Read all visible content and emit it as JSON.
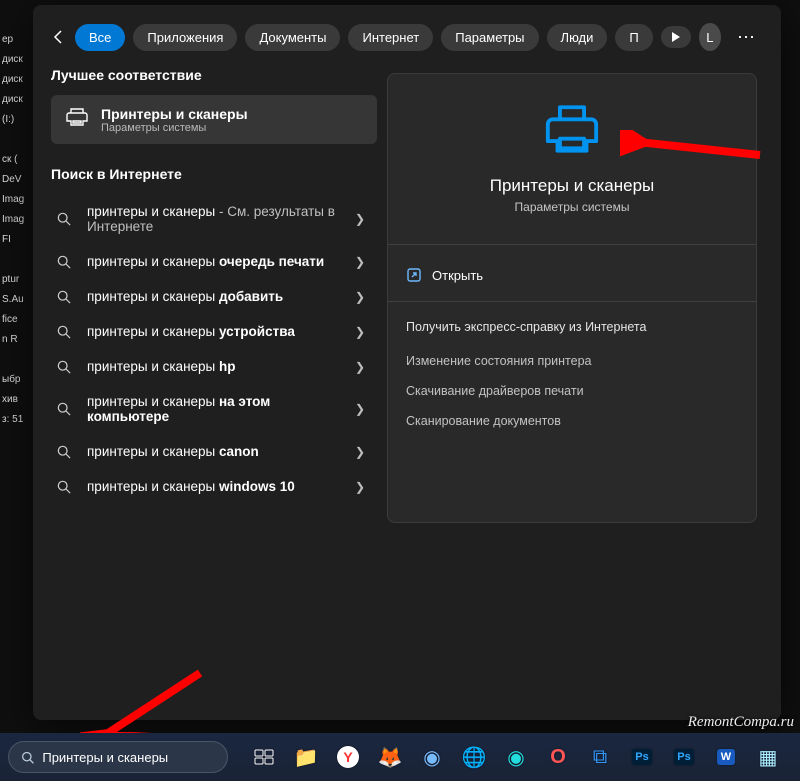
{
  "filters": {
    "all": "Все",
    "apps": "Приложения",
    "docs": "Документы",
    "web": "Интернет",
    "settings": "Параметры",
    "people": "Люди",
    "more": "П"
  },
  "avatar_letter": "L",
  "left": {
    "best_header": "Лучшее соответствие",
    "best_title": "Принтеры и сканеры",
    "best_sub": "Параметры системы",
    "web_header": "Поиск в Интернете",
    "results": [
      {
        "prefix": "принтеры и сканеры",
        "bold": "",
        "suffix": " - См. результаты в Интернете"
      },
      {
        "prefix": "принтеры и сканеры ",
        "bold": "очередь печати",
        "suffix": ""
      },
      {
        "prefix": "принтеры и сканеры ",
        "bold": "добавить",
        "suffix": ""
      },
      {
        "prefix": "принтеры и сканеры ",
        "bold": "устройства",
        "suffix": ""
      },
      {
        "prefix": "принтеры и сканеры ",
        "bold": "hp",
        "suffix": ""
      },
      {
        "prefix": "принтеры и сканеры ",
        "bold": "на этом компьютере",
        "suffix": ""
      },
      {
        "prefix": "принтеры и сканеры ",
        "bold": "canon",
        "suffix": ""
      },
      {
        "prefix": "принтеры и сканеры ",
        "bold": "windows 10",
        "suffix": ""
      }
    ]
  },
  "preview": {
    "title": "Принтеры и сканеры",
    "sub": "Параметры системы",
    "open": "Открыть",
    "help_title": "Получить экспресс-справку из Интернета",
    "help_items": [
      "Изменение состояния принтера",
      "Скачивание драйверов печати",
      "Сканирование документов"
    ]
  },
  "taskbar": {
    "search_value": "Принтеры и сканеры"
  },
  "watermark": "RemontCompa.ru",
  "desktop_items": [
    "ер",
    "диск",
    "диск",
    "диск",
    "(I:)",
    "",
    "ск (",
    "DeV",
    "Imag",
    "Imag",
    "FI",
    "",
    "ptur",
    "S.Au",
    "fice",
    "n R",
    "",
    "ыбр",
    "хив",
    "з: 51"
  ]
}
